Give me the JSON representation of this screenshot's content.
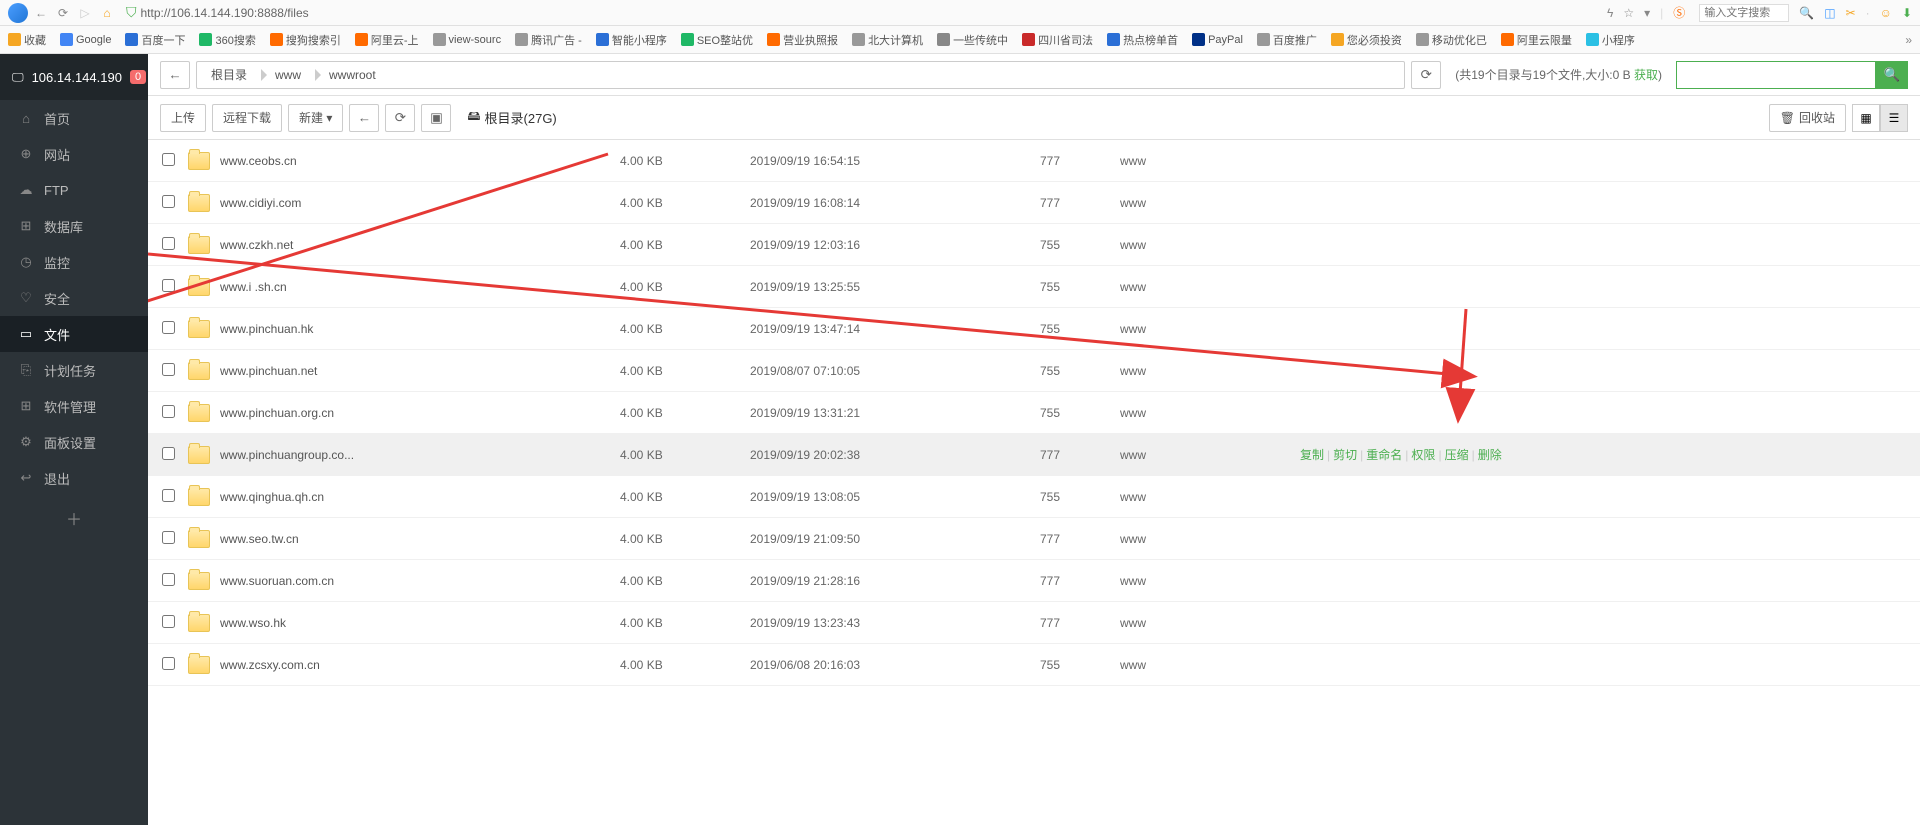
{
  "browser": {
    "url": "http://106.14.144.190:8888/files",
    "search_placeholder": "输入文字搜索"
  },
  "bookmarks": [
    {
      "icon": "star",
      "color": "#f5a623",
      "label": "收藏"
    },
    {
      "icon": "g",
      "color": "#4285f4",
      "label": "Google"
    },
    {
      "icon": "paw",
      "color": "#2b6fd6",
      "label": "百度一下"
    },
    {
      "icon": "360",
      "color": "#1fb866",
      "label": "360搜索"
    },
    {
      "icon": "s",
      "color": "#ff6a00",
      "label": "搜狗搜索引"
    },
    {
      "icon": "ali",
      "color": "#ff6a00",
      "label": "阿里云-上"
    },
    {
      "icon": "doc",
      "color": "#999",
      "label": "view-sourc"
    },
    {
      "icon": "doc",
      "color": "#999",
      "label": "腾讯广告 -"
    },
    {
      "icon": "sp",
      "color": "#2b6fd6",
      "label": "智能小程序"
    },
    {
      "icon": "seo",
      "color": "#1fb866",
      "label": "SEO整站优"
    },
    {
      "icon": "doc",
      "color": "#ff6a00",
      "label": "营业执照报"
    },
    {
      "icon": "doc",
      "color": "#999",
      "label": "北大计算机"
    },
    {
      "icon": "cloud",
      "color": "#888",
      "label": "一些传统中"
    },
    {
      "icon": "sc",
      "color": "#c92a2a",
      "label": "四川省司法"
    },
    {
      "icon": "hot",
      "color": "#2b6fd6",
      "label": "热点榜单首"
    },
    {
      "icon": "pp",
      "color": "#003087",
      "label": "PayPal"
    },
    {
      "icon": "doc",
      "color": "#999",
      "label": "百度推广"
    },
    {
      "icon": "warn",
      "color": "#f5a623",
      "label": "您必须投资"
    },
    {
      "icon": "doc",
      "color": "#999",
      "label": "移动优化已"
    },
    {
      "icon": "ali",
      "color": "#ff6a00",
      "label": "阿里云限量"
    },
    {
      "icon": "sp",
      "color": "#2bc0e4",
      "label": "小程序"
    }
  ],
  "server": {
    "ip": "106.14.144.190",
    "badge": "0"
  },
  "sidebar": [
    {
      "icon": "⌂",
      "label": "首页"
    },
    {
      "icon": "⊕",
      "label": "网站"
    },
    {
      "icon": "☁",
      "label": "FTP"
    },
    {
      "icon": "⊞",
      "label": "数据库"
    },
    {
      "icon": "◷",
      "label": "监控"
    },
    {
      "icon": "♡",
      "label": "安全"
    },
    {
      "icon": "▭",
      "label": "文件",
      "active": true
    },
    {
      "icon": "⎘",
      "label": "计划任务"
    },
    {
      "icon": "⊞",
      "label": "软件管理"
    },
    {
      "icon": "⚙",
      "label": "面板设置"
    },
    {
      "icon": "↩",
      "label": "退出"
    }
  ],
  "breadcrumb": [
    "根目录",
    "www",
    "wwwroot"
  ],
  "info": {
    "text": "(共19个目录与19个文件,大小:0 B",
    "link": "获取",
    "suffix": ")"
  },
  "toolbar2": {
    "upload": "上传",
    "remote": "远程下载",
    "new": "新建 ▾",
    "root": "根目录(27G)",
    "recycle": "回收站"
  },
  "actions": [
    "复制",
    "剪切",
    "重命名",
    "权限",
    "压缩",
    "删除"
  ],
  "files": [
    {
      "name": "www.ceobs.cn",
      "size": "4.00 KB",
      "date": "2019/09/19 16:54:15",
      "perm": "777",
      "owner": "www"
    },
    {
      "name": "www.cidiyi.com",
      "size": "4.00 KB",
      "date": "2019/09/19 16:08:14",
      "perm": "777",
      "owner": "www"
    },
    {
      "name": "www.czkh.net",
      "size": "4.00 KB",
      "date": "2019/09/19 12:03:16",
      "perm": "755",
      "owner": "www"
    },
    {
      "name": "www.i    .sh.cn",
      "size": "4.00 KB",
      "date": "2019/09/19 13:25:55",
      "perm": "755",
      "owner": "www"
    },
    {
      "name": "www.pinchuan.hk",
      "size": "4.00 KB",
      "date": "2019/09/19 13:47:14",
      "perm": "755",
      "owner": "www"
    },
    {
      "name": "www.pinchuan.net",
      "size": "4.00 KB",
      "date": "2019/08/07 07:10:05",
      "perm": "755",
      "owner": "www"
    },
    {
      "name": "www.pinchuan.org.cn",
      "size": "4.00 KB",
      "date": "2019/09/19 13:31:21",
      "perm": "755",
      "owner": "www"
    },
    {
      "name": "www.pinchuangroup.co...",
      "size": "4.00 KB",
      "date": "2019/09/19 20:02:38",
      "perm": "777",
      "owner": "www",
      "highlighted": true,
      "showActions": true
    },
    {
      "name": "www.qinghua.qh.cn",
      "size": "4.00 KB",
      "date": "2019/09/19 13:08:05",
      "perm": "755",
      "owner": "www"
    },
    {
      "name": "www.seo.tw.cn",
      "size": "4.00 KB",
      "date": "2019/09/19 21:09:50",
      "perm": "777",
      "owner": "www"
    },
    {
      "name": "www.suoruan.com.cn",
      "size": "4.00 KB",
      "date": "2019/09/19 21:28:16",
      "perm": "777",
      "owner": "www"
    },
    {
      "name": "www.wso.hk",
      "size": "4.00 KB",
      "date": "2019/09/19 13:23:43",
      "perm": "777",
      "owner": "www"
    },
    {
      "name": "www.zcsxy.com.cn",
      "size": "4.00 KB",
      "date": "2019/06/08 20:16:03",
      "perm": "755",
      "owner": "www"
    }
  ]
}
